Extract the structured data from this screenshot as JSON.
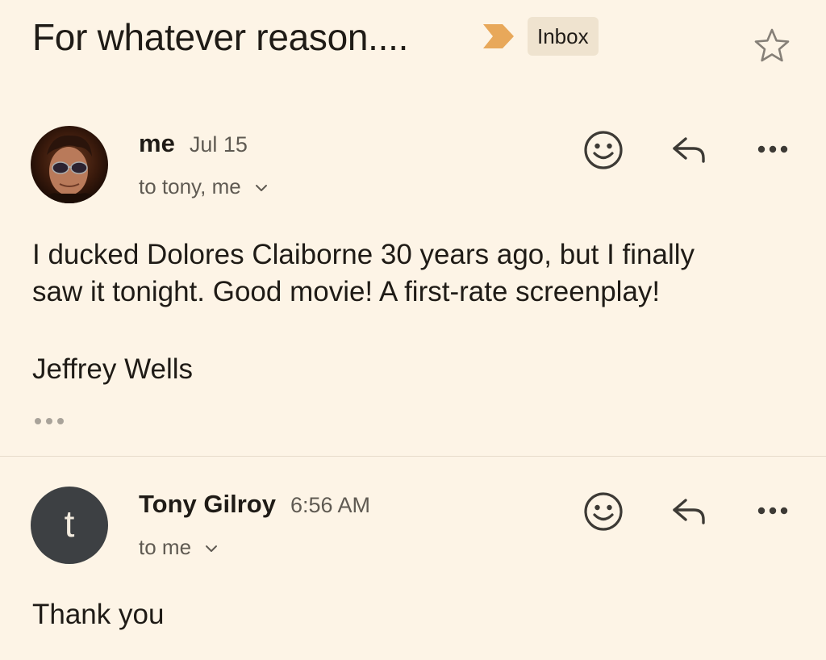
{
  "thread": {
    "subject": "For whatever reason....",
    "label": "Inbox",
    "icons": {
      "importance": "importance-marker-icon",
      "star": "star-icon"
    },
    "colors": {
      "background": "#fdf4e6",
      "importance_marker": "#e8a85a",
      "label_chip": "#efe3cf",
      "avatar_tony": "#3d4043"
    }
  },
  "messages": [
    {
      "sender": "me",
      "date": "Jul 15",
      "recipients": "to tony, me",
      "body": [
        "I ducked Dolores Claiborne 30 years ago, but I finally",
        "saw it tonight. Good movie!  A first-rate screenplay!"
      ],
      "signature": "Jeffrey Wells",
      "avatar": "profile-photo",
      "actions": [
        "smiley-icon",
        "reply-icon",
        "more-icon"
      ]
    },
    {
      "sender": "Tony Gilroy",
      "date": "6:56 AM",
      "recipients": "to me",
      "avatar_letter": "t",
      "body": [
        "Thank you"
      ],
      "actions": [
        "smiley-icon",
        "reply-icon",
        "more-icon"
      ]
    }
  ]
}
